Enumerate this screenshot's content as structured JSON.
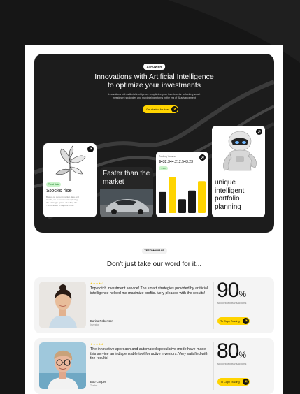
{
  "hero": {
    "badge": "AI POWER",
    "title_line1": "Innovations with Artificial Intelligence",
    "title_line2": "to optimize your investments",
    "subtitle_line1": "Innovations with artificial intelligence to optimize your investments: unlocking smart",
    "subtitle_line2": "investment strategies and maximizing returns in the era of AI advancement",
    "cta_label": "Get started for free"
  },
  "cards": {
    "stocks": {
      "tag": "Trend data",
      "title": "Stocks rise",
      "text": "Based on current market data and trends, we recommend exploring the strategic option of selling the TSVM asset to capture profit."
    },
    "market": {
      "title": "Faster than the market"
    },
    "volume": {
      "label": "Trading Volume",
      "value": "$432,344,212,543.23",
      "change": "↑ 5%",
      "bars": [
        {
          "value": 0.58,
          "color": "#1a1a1a"
        },
        {
          "value": 1.0,
          "color": "#ffd400"
        },
        {
          "value": 0.38,
          "color": "#1a1a1a"
        },
        {
          "value": 0.62,
          "color": "#1a1a1a"
        },
        {
          "value": 0.88,
          "color": "#ffd400"
        }
      ]
    },
    "portfolio": {
      "title": "unique intelligent portfolio planning"
    }
  },
  "testimonials": {
    "badge": "TESTIMONIALS",
    "title": "Don't just take our word for it...",
    "items": [
      {
        "stars": "★★★★☆",
        "quote": "Top-notch investment service! The smart strategies provided by artificial intelligence helped me maximize profits. Very pleased with the results!",
        "name": "Darina Robertson",
        "role": "Investor",
        "stat_number": "90",
        "stat_unit": "%",
        "stat_label": "successful transactions",
        "button": "To Copy Trading"
      },
      {
        "stars": "★★★★★",
        "quote": "The innovative approach and automated speculative mode have made this service an indispensable tool for active investors. Very satisfied with the results!",
        "name": "Bob Cooper",
        "role": "Trader",
        "stat_number": "80",
        "stat_unit": "%",
        "stat_label": "successful transactions",
        "button": "To Copy Trading"
      }
    ]
  },
  "colors": {
    "accent": "#ffd400",
    "dark": "#1c1c1c",
    "positive": "#1d7d2b"
  },
  "icons": {
    "cta": "arrow-up-right-icon",
    "card": "arrow-up-right-icon",
    "stars": "star-icon"
  }
}
